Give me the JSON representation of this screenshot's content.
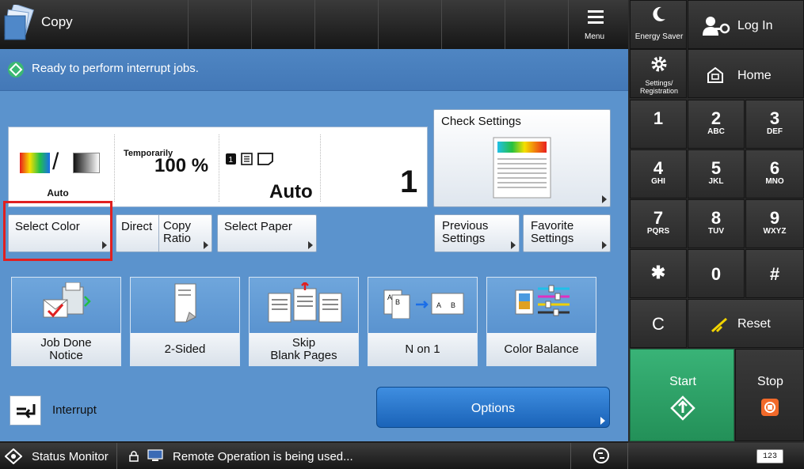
{
  "topbar": {
    "title": "Copy",
    "menu_label": "Menu"
  },
  "right": {
    "energy_saver": "Energy Saver",
    "login": "Log In",
    "settings": "Settings/\nRegistration",
    "home": "Home",
    "keys": [
      {
        "n": "1",
        "l": ""
      },
      {
        "n": "2",
        "l": "ABC"
      },
      {
        "n": "3",
        "l": "DEF"
      },
      {
        "n": "4",
        "l": "GHI"
      },
      {
        "n": "5",
        "l": "JKL"
      },
      {
        "n": "6",
        "l": "MNO"
      },
      {
        "n": "7",
        "l": "PQRS"
      },
      {
        "n": "8",
        "l": "TUV"
      },
      {
        "n": "9",
        "l": "WXYZ"
      },
      {
        "n": "✱",
        "l": ""
      },
      {
        "n": "0",
        "l": ""
      },
      {
        "n": "#",
        "l": ""
      }
    ],
    "clear": "C",
    "reset": "Reset",
    "start": "Start",
    "stop": "Stop"
  },
  "status": {
    "message": "Ready to perform interrupt jobs."
  },
  "settings_summary": {
    "color": "Auto",
    "ratio_caption": "Temporarily",
    "ratio": "100 %",
    "paper": "Auto",
    "copies": "1"
  },
  "buttons": {
    "select_color": "Select Color",
    "direct": "Direct",
    "copy_ratio": "Copy Ratio",
    "select_paper": "Select Paper",
    "check_settings": "Check Settings",
    "previous_settings": "Previous Settings",
    "favorite_settings": "Favorite Settings",
    "options": "Options",
    "interrupt": "Interrupt"
  },
  "functions": [
    {
      "label": "Job Done\nNotice"
    },
    {
      "label": "2-Sided"
    },
    {
      "label": "Skip\nBlank Pages"
    },
    {
      "label": "N on 1"
    },
    {
      "label": "Color Balance"
    }
  ],
  "bottombar": {
    "status_monitor": "Status Monitor",
    "remote": "Remote Operation is being used...",
    "keypad_toggle": "123"
  },
  "colors": {
    "accent": "#5b93cd",
    "start": "#2fa36b",
    "highlight_box": "#e02020"
  }
}
